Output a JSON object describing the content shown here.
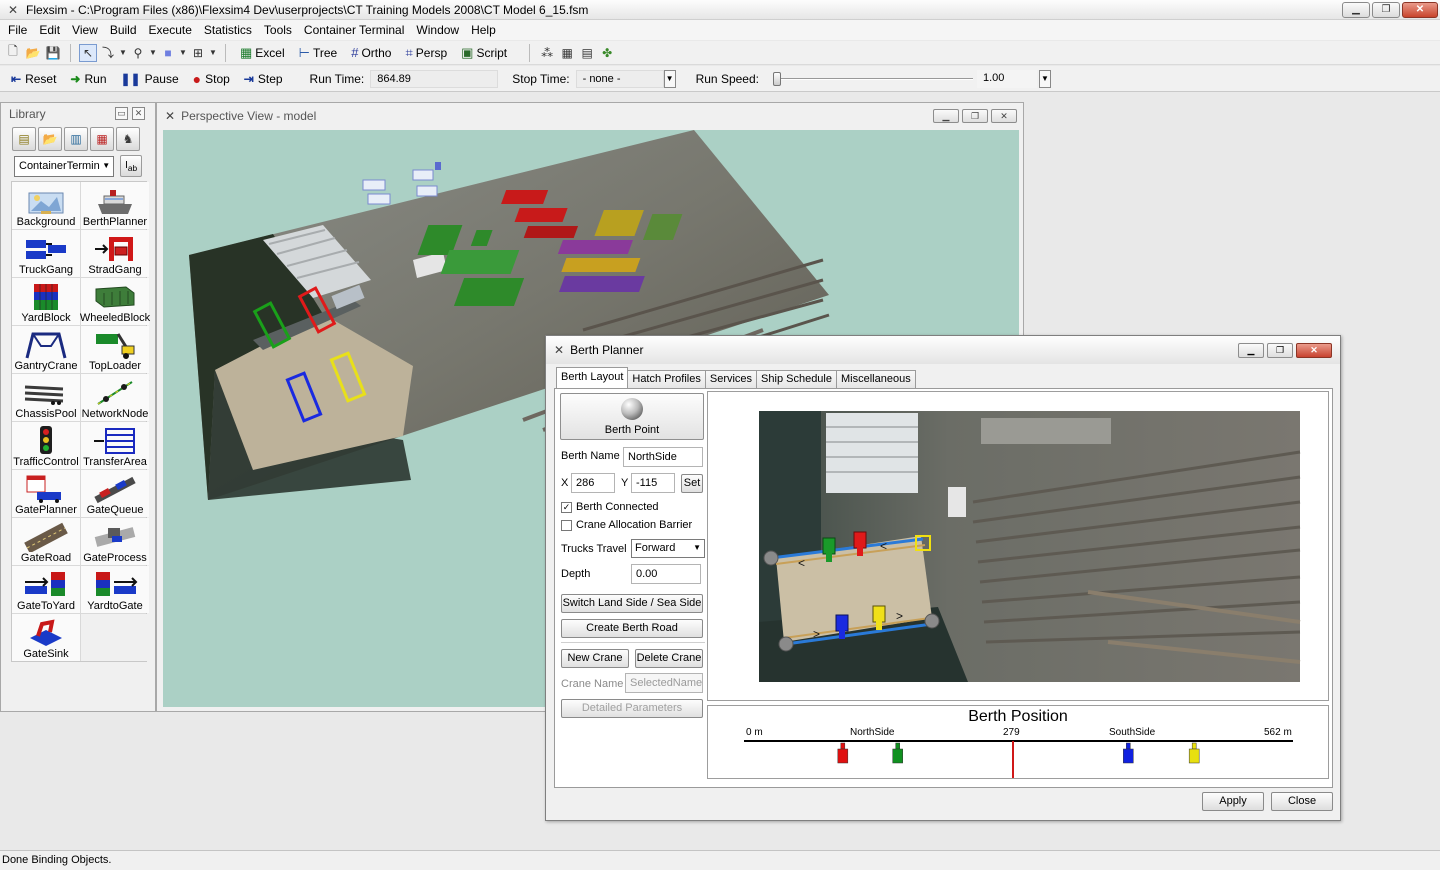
{
  "window": {
    "title": "Flexsim - C:\\Program Files (x86)\\Flexsim4 Dev\\userprojects\\CT Training Models 2008\\CT Model 6_15.fsm"
  },
  "menu": [
    "File",
    "Edit",
    "View",
    "Build",
    "Execute",
    "Statistics",
    "Tools",
    "Container Terminal",
    "Window",
    "Help"
  ],
  "toolbar": {
    "excel": "Excel",
    "tree": "Tree",
    "ortho": "Ortho",
    "persp": "Persp",
    "script": "Script"
  },
  "runbar": {
    "reset": "Reset",
    "run": "Run",
    "pause": "Pause",
    "stop": "Stop",
    "step": "Step",
    "run_time_label": "Run Time:",
    "run_time_value": "864.89",
    "stop_time_label": "Stop Time:",
    "stop_time_value": "- none -",
    "run_speed_label": "Run Speed:",
    "run_speed_value": "1.00"
  },
  "library": {
    "title": "Library",
    "selected": "ContainerTermin",
    "items": [
      {
        "label": "Background",
        "icon": "background-icon"
      },
      {
        "label": "BerthPlanner",
        "icon": "ship-icon"
      },
      {
        "label": "TruckGang",
        "icon": "truck-gang-icon"
      },
      {
        "label": "StradGang",
        "icon": "straddle-carrier-icon"
      },
      {
        "label": "YardBlock",
        "icon": "yard-block-icon"
      },
      {
        "label": "WheeledBlock",
        "icon": "wheeled-block-icon"
      },
      {
        "label": "GantryCrane",
        "icon": "gantry-crane-icon"
      },
      {
        "label": "TopLoader",
        "icon": "top-loader-icon"
      },
      {
        "label": "ChassisPool",
        "icon": "chassis-pool-icon"
      },
      {
        "label": "NetworkNode",
        "icon": "network-node-icon"
      },
      {
        "label": "TrafficControl",
        "icon": "traffic-light-icon"
      },
      {
        "label": "TransferArea",
        "icon": "transfer-area-icon"
      },
      {
        "label": "GatePlanner",
        "icon": "gate-planner-icon"
      },
      {
        "label": "GateQueue",
        "icon": "gate-queue-icon"
      },
      {
        "label": "GateRoad",
        "icon": "gate-road-icon"
      },
      {
        "label": "GateProcess",
        "icon": "gate-process-icon"
      },
      {
        "label": "GateToYard",
        "icon": "gate-to-yard-icon"
      },
      {
        "label": "YardtoGate",
        "icon": "yard-to-gate-icon"
      },
      {
        "label": "GateSink",
        "icon": "gate-sink-icon"
      }
    ]
  },
  "perspective": {
    "title": "Perspective View - model"
  },
  "berth_planner": {
    "title": "Berth Planner",
    "tabs": [
      "Berth Layout",
      "Hatch Profiles",
      "Services",
      "Ship Schedule",
      "Miscellaneous"
    ],
    "berth_point": "Berth Point",
    "berth_name_label": "Berth Name",
    "berth_name": "NorthSide",
    "x_label": "X",
    "x": "286",
    "y_label": "Y",
    "y": "-115",
    "set": "Set",
    "berth_connected": "Berth Connected",
    "crane_allocation_barrier": "Crane Allocation Barrier",
    "trucks_travel_label": "Trucks Travel",
    "trucks_travel": "Forward",
    "depth_label": "Depth",
    "depth": "0.00",
    "switch_side": "Switch Land Side / Sea Side",
    "create_road": "Create Berth Road",
    "new_crane": "New Crane",
    "delete_crane": "Delete Crane",
    "crane_name_label": "Crane Name",
    "crane_name": "SelectedName",
    "detailed_parameters": "Detailed Parameters",
    "position": {
      "title": "Berth Position",
      "start": "0 m",
      "north": "NorthSide",
      "mid": "279",
      "south": "SouthSide",
      "end": "562 m",
      "cranes": [
        {
          "color": "#e01010",
          "pos": 0.18
        },
        {
          "color": "#109020",
          "pos": 0.28
        },
        {
          "color": "#1020e0",
          "pos": 0.7
        },
        {
          "color": "#e8e010",
          "pos": 0.82
        }
      ],
      "marker": 0.49
    },
    "apply": "Apply",
    "close": "Close"
  },
  "status": "Done Binding Objects."
}
